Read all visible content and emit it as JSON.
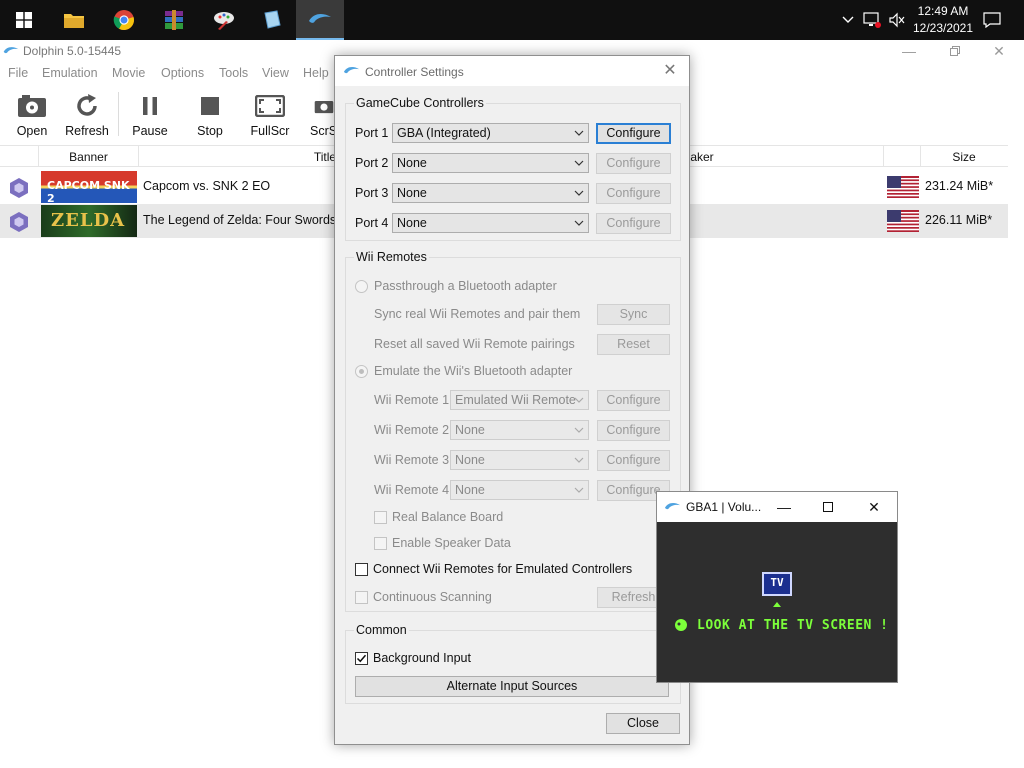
{
  "taskbar": {
    "clock_time": "12:49 AM",
    "clock_date": "12/23/2021",
    "apps": [
      "start-icon",
      "file-explorer-icon",
      "chrome-icon",
      "winrar-icon",
      "paint-icon",
      "notepad-icon",
      "dolphin-icon"
    ]
  },
  "main_window": {
    "title": "Dolphin 5.0-15445",
    "menu": [
      "File",
      "Emulation",
      "Movie",
      "Options",
      "Tools",
      "View",
      "Help"
    ],
    "toolbar": [
      "Open",
      "Refresh",
      "Pause",
      "Stop",
      "FullScr",
      "ScrSh"
    ],
    "columns": {
      "banner": "Banner",
      "title": "Title",
      "maker": "Maker",
      "size": "Size"
    },
    "games": [
      {
        "title": "Capcom vs. SNK 2 EO",
        "size": "231.24 MiB*",
        "banner_text": "CAPCOM SNK 2"
      },
      {
        "title": "The Legend of Zelda: Four Swords Ad",
        "size": "226.11 MiB*",
        "banner_text": "ZELDA"
      }
    ],
    "colors": {
      "selected_row": "#e8e8e8"
    }
  },
  "dialog": {
    "title": "Controller Settings",
    "gamecube": {
      "title": "GameCube Controllers",
      "ports": [
        {
          "label": "Port 1",
          "value": "GBA (Integrated)",
          "button": "Configure"
        },
        {
          "label": "Port 2",
          "value": "None",
          "button": "Configure"
        },
        {
          "label": "Port 3",
          "value": "None",
          "button": "Configure"
        },
        {
          "label": "Port 4",
          "value": "None",
          "button": "Configure"
        }
      ]
    },
    "wii": {
      "title": "Wii Remotes",
      "passthrough": "Passthrough a Bluetooth adapter",
      "sync_text": "Sync real Wii Remotes and pair them",
      "sync_button": "Sync",
      "reset_text": "Reset all saved Wii Remote pairings",
      "reset_button": "Reset",
      "emulate": "Emulate the Wii's Bluetooth adapter",
      "remotes": [
        {
          "label": "Wii Remote 1",
          "value": "Emulated Wii Remote",
          "button": "Configure"
        },
        {
          "label": "Wii Remote 2",
          "value": "None",
          "button": "Configure"
        },
        {
          "label": "Wii Remote 3",
          "value": "None",
          "button": "Configure"
        },
        {
          "label": "Wii Remote 4",
          "value": "None",
          "button": "Configure"
        }
      ],
      "balance_board": "Real Balance Board",
      "speaker": "Enable Speaker Data",
      "connect_emulated": "Connect Wii Remotes for Emulated Controllers",
      "continuous": "Continuous Scanning",
      "refresh_button": "Refresh"
    },
    "common": {
      "title": "Common",
      "background_input": "Background Input",
      "background_input_checked": true,
      "alternate": "Alternate Input Sources"
    },
    "close_button": "Close"
  },
  "gba_window": {
    "title": "GBA1 | Volu...",
    "tv_label": "TV",
    "message": "LOOK AT THE TV SCREEN !"
  }
}
